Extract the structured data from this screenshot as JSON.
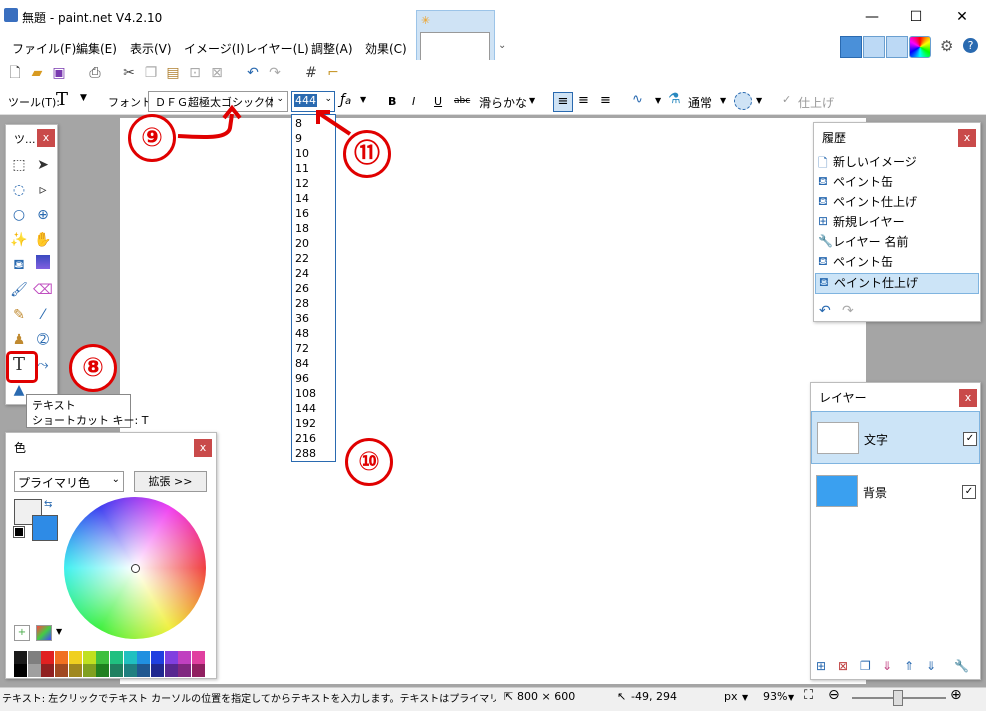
{
  "window": {
    "title": "無題 - paint.net V4.2.10",
    "minimize": "—",
    "maximize": "☐",
    "close": "✕"
  },
  "menu": [
    "ファイル(F)",
    "編集(E)",
    "表示(V)",
    "イメージ(I)",
    "レイヤー(L)",
    "調整(A)",
    "効果(C)"
  ],
  "toolbar2": {
    "tool_label": "ツール(T):",
    "tool_icon": "T",
    "font_label": "フォント:",
    "font_value": "ＤＦＧ超極太ゴシック体",
    "size_value": "444",
    "bold": "B",
    "italic": "I",
    "underline": "U",
    "strike": "abc",
    "smoothing": "滑らかな",
    "blend_mode": "通常",
    "finish": "仕上げ"
  },
  "font_sizes": [
    "8",
    "9",
    "10",
    "11",
    "12",
    "14",
    "16",
    "18",
    "20",
    "22",
    "24",
    "26",
    "28",
    "36",
    "48",
    "72",
    "84",
    "96",
    "108",
    "144",
    "192",
    "216",
    "288"
  ],
  "tools_panel": {
    "title": "ツ...",
    "close": "x"
  },
  "tooltip": {
    "line1": "テキスト",
    "line2": "ショートカット キー: T"
  },
  "annotations": [
    "⑧",
    "⑨",
    "⑩",
    "⑪"
  ],
  "history_panel": {
    "title": "履歴",
    "close": "x",
    "items": [
      "新しいイメージ",
      "ペイント缶",
      "ペイント仕上げ",
      "新規レイヤー",
      "レイヤー 名前",
      "ペイント缶",
      "ペイント仕上げ"
    ],
    "selected_index": 6
  },
  "colors_panel": {
    "title": "色",
    "close": "x",
    "mode": "プライマリ色",
    "expand": "拡張 >>",
    "primary": "#f0f0f0",
    "secondary": "#2e8be6",
    "palette_row1": [
      "#1a1a1a",
      "#7f7f7f",
      "#e02020",
      "#f07020",
      "#f0d020",
      "#c0e020",
      "#40c040",
      "#20c080",
      "#20c0c0",
      "#2090e0",
      "#2040e0",
      "#8040e0",
      "#c040c0",
      "#e040a0"
    ],
    "palette_row2": [
      "#000000",
      "#a0a0a0",
      "#902020",
      "#a04820",
      "#a08820",
      "#80a020",
      "#208020",
      "#208060",
      "#208080",
      "#205890",
      "#202890",
      "#582890",
      "#802880",
      "#902060"
    ]
  },
  "layers_panel": {
    "title": "レイヤー",
    "close": "x",
    "layers": [
      {
        "name": "文字",
        "checked": "✓"
      },
      {
        "name": "背景",
        "checked": "✓"
      }
    ],
    "background_color": "#3aa0f0"
  },
  "status_bar": {
    "help_text": "テキスト: 左クリックでテキスト カーソルの位置を指定してからテキストを入力します。テキストはプライマリ色で書かれます。",
    "image_size": "800 × 600",
    "cursor_pos": "-49, 294",
    "unit": "px",
    "zoom": "93%"
  }
}
